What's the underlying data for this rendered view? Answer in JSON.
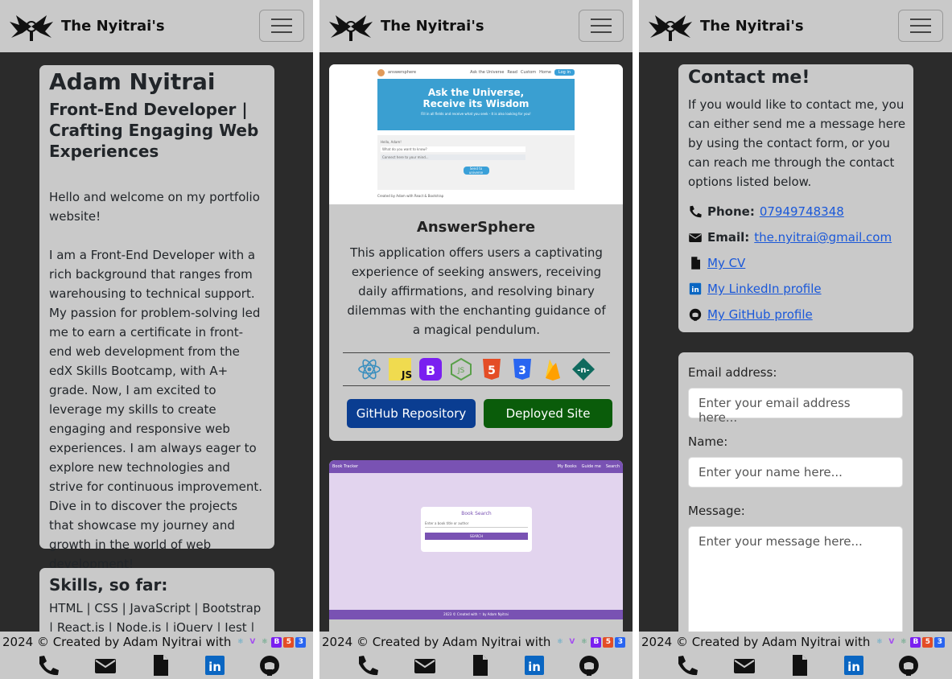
{
  "brand": {
    "name": "The Nyitrai's"
  },
  "about": {
    "name": "Adam Nyitrai",
    "tagline": "Front-End Developer | Crafting Engaging Web Experiences",
    "welcome": "Hello and welcome on my portfolio website!",
    "bio": "I am a Front-End Developer with a rich background that ranges from warehousing to technical support. My passion for problem-solving led me to earn a certificate in front-end web development from the edX Skills Bootcamp, with A+ grade. Now, I am excited to leverage my skills to create engaging and responsive web experiences. I am always eager to explore new technologies and strive for continuous improvement. Dive in to discover the projects that showcase my journey and growth in the world of web development!"
  },
  "skills": {
    "title": "Skills, so far:",
    "list": "HTML | CSS | JavaScript | Bootstrap | React.js | Node.js | jQuery | Jest | APIs |"
  },
  "project1": {
    "title": "AnswerSphere",
    "description": "This application offers users a captivating experience of seeking answers, receiving daily affirmations, and resolving binary dilemmas with the enchanting guidance of a magical pendulum.",
    "repo_button": "GitHub Repository",
    "deploy_button": "Deployed Site",
    "preview": {
      "site_name": "answersphere",
      "nav": [
        "Ask the Universe",
        "Read",
        "Custom",
        "Home"
      ],
      "nav_button": "Log in",
      "hero_title_1": "Ask the Universe,",
      "hero_title_2": "Receive its Wisdom",
      "hero_sub": "Fill in all fields and receive what you seek - it is also looking for you!",
      "form_greeting": "Hello, Adam!",
      "select_placeholder": "What do you want to know?",
      "textarea_placeholder": "Connect here to your mind...",
      "submit": "Send to universe",
      "footer": "Created by Adam with React & Bootstrap"
    }
  },
  "project2": {
    "preview": {
      "site_name": "Book Tracker",
      "nav": [
        "My Books",
        "Guide me",
        "Search"
      ],
      "search_title": "Book Search",
      "search_placeholder": "Enter a book title or author",
      "search_button": "SEARCH",
      "footer": "2023 © Created with ♡ by Adam Nyitrai"
    }
  },
  "contact": {
    "title": "Contact me!",
    "intro": "If you would like to contact me, you can either send me a message here by using the contact form, or you can reach me through the contact options listed below.",
    "phone_label": "Phone:",
    "phone": "07949748348",
    "email_label": "Email:",
    "email": "the.nyitrai@gmail.com",
    "cv": "My CV",
    "linkedin": "My LinkedIn profile",
    "github": "My GitHub profile"
  },
  "form": {
    "email_label": "Email address:",
    "email_placeholder": "Enter your email address here...",
    "name_label": "Name:",
    "name_placeholder": "Enter your name here...",
    "message_label": "Message:",
    "message_placeholder": "Enter your message here..."
  },
  "footer": {
    "credits": "2024 © Created by Adam Nyitrai with"
  },
  "colors": {
    "panel_bg": "#2b2b2b",
    "card_bg": "#c9c9c9",
    "repo_button": "#0a3d91",
    "deploy_button": "#0a5c0a",
    "link": "#1a58d9",
    "book_purple": "#7952b3"
  },
  "icons": [
    "phone-icon",
    "envelope-icon",
    "file-icon",
    "linkedin-icon",
    "github-icon",
    "react-icon",
    "javascript-icon",
    "bootstrap-icon",
    "nodejs-icon",
    "html5-icon",
    "css3-icon",
    "firebase-icon",
    "netlify-icon",
    "menu-icon"
  ]
}
